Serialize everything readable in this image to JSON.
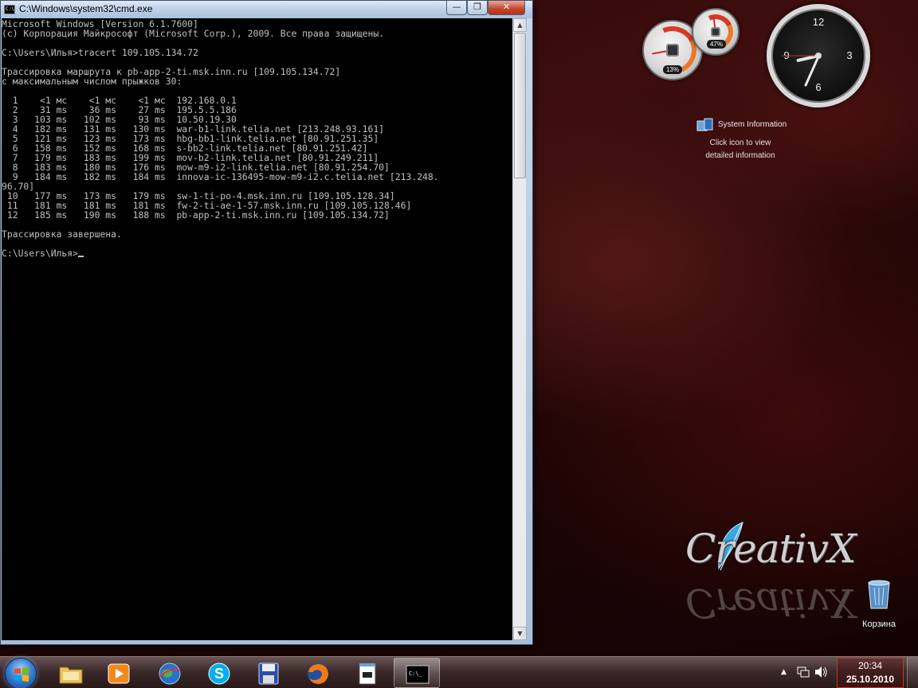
{
  "cmd": {
    "title": "C:\\Windows\\system32\\cmd.exe",
    "title_icon_text": "C:\\",
    "buttons": {
      "minimize": "—",
      "maximize": "❐",
      "close": "✕"
    },
    "lines": [
      "Microsoft Windows [Version 6.1.7600]",
      "(c) Корпорация Майкрософт (Microsoft Corp.), 2009. Все права защищены.",
      "",
      "C:\\Users\\Илья>tracert 109.105.134.72",
      "",
      "Трассировка маршрута к pb-app-2-ti.msk.inn.ru [109.105.134.72]",
      "с максимальным числом прыжков 30:",
      "",
      "  1    <1 мс    <1 мс    <1 мс  192.168.0.1",
      "  2    31 ms    36 ms    27 ms  195.5.5.186",
      "  3   103 ms   102 ms    93 ms  10.50.19.30",
      "  4   182 ms   131 ms   130 ms  war-b1-link.telia.net [213.248.93.161]",
      "  5   121 ms   123 ms   173 ms  hbg-bb1-link.telia.net [80.91.251.35]",
      "  6   158 ms   152 ms   168 ms  s-bb2-link.telia.net [80.91.251.42]",
      "  7   179 ms   183 ms   199 ms  mov-b2-link.telia.net [80.91.249.211]",
      "  8   183 ms   180 ms   176 ms  mow-m9-i2-link.telia.net [80.91.254.70]",
      "  9   184 ms   182 ms   184 ms  innova-ic-136495-mow-m9-i2.c.telia.net [213.248.",
      "96.70]",
      " 10   177 ms   173 ms   179 ms  sw-1-ti-po-4.msk.inn.ru [109.105.128.34]",
      " 11   181 ms   181 ms   181 ms  fw-2-ti-ae-1-57.msk.inn.ru [109.105.128.46]",
      " 12   185 ms   190 ms   188 ms  pb-app-2-ti.msk.inn.ru [109.105.134.72]",
      "",
      "Трассировка завершена.",
      ""
    ],
    "prompt": "C:\\Users\\Илья>"
  },
  "gadgets": {
    "cpu_percent": "13%",
    "ram_percent": "47%",
    "cpu_level": 0.13,
    "ram_level": 0.47,
    "clock_numbers": [
      "12",
      "3",
      "6",
      "9"
    ],
    "clock_time": {
      "hour": 20,
      "minute": 34,
      "second": 45
    },
    "sysinfo": {
      "title": "System Information",
      "hint_line1": "Click icon to view",
      "hint_line2": "detailed information"
    }
  },
  "desktop": {
    "logo_text": "CreativX",
    "recycle_label": "Корзина"
  },
  "taskbar": {
    "apps": [
      {
        "name": "explorer",
        "icon": "folder-icon",
        "active": false
      },
      {
        "name": "media-player",
        "icon": "media-player-icon",
        "active": false
      },
      {
        "name": "google-earth",
        "icon": "globe-icon",
        "active": false
      },
      {
        "name": "skype",
        "icon": "skype-icon",
        "active": false
      },
      {
        "name": "save",
        "icon": "floppy-icon",
        "active": false
      },
      {
        "name": "firefox",
        "icon": "firefox-icon",
        "active": false
      },
      {
        "name": "notepad",
        "icon": "notepad-icon",
        "active": false
      },
      {
        "name": "cmd",
        "icon": "cmd-icon",
        "active": true,
        "icon_text": "C:\\_"
      }
    ],
    "time": "20:34",
    "date": "25.10.2010"
  },
  "colors": {
    "console_bg": "#000000",
    "console_text": "#c0c0c0",
    "accent_red": "#c03a2a"
  }
}
